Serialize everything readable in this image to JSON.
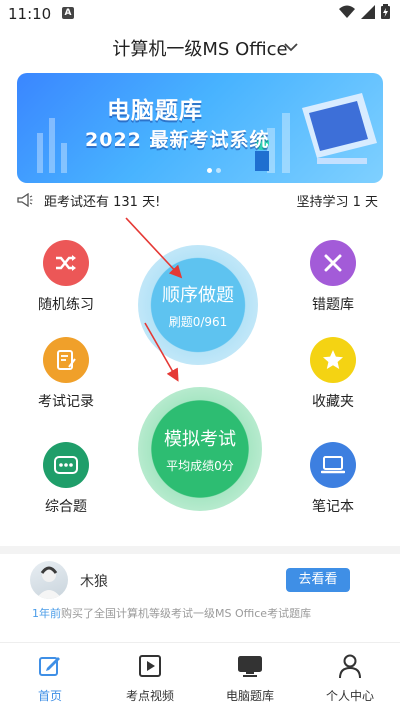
{
  "status_bar": {
    "time": "11:10",
    "indicator": "A"
  },
  "header": {
    "title": "计算机一级MS Office"
  },
  "banner": {
    "title": "电脑题库",
    "subtitle": "2022 最新考试系统"
  },
  "countdown": {
    "left_text": "距考试还有 131 天!",
    "right_text": "坚持学习 1 天"
  },
  "features": {
    "random": {
      "label": "随机练习",
      "color": "#ec5757"
    },
    "wrong": {
      "label": "错题库",
      "color": "#a35bd8"
    },
    "records": {
      "label": "考试记录",
      "color": "#f0a02a"
    },
    "favorites": {
      "label": "收藏夹",
      "color": "#f4d313"
    },
    "comprehensive": {
      "label": "综合题",
      "color": "#1f9e6a"
    },
    "notebook": {
      "label": "笔记本",
      "color": "#3d7fe0"
    }
  },
  "sequential": {
    "title": "顺序做题",
    "progress": "刷题0/961",
    "color": "#4eb4e8"
  },
  "mock": {
    "title": "模拟考试",
    "score": "平均成绩0分",
    "color": "#2dbd72"
  },
  "activity": {
    "username": "木狼",
    "button": "去看看",
    "time": "1年前",
    "text": "购买了全国计算机等级考试一级MS Office考试题库"
  },
  "tabs": [
    {
      "label": "首页",
      "icon": "edit-icon",
      "active": true
    },
    {
      "label": "考点视频",
      "icon": "video-play-icon",
      "active": false
    },
    {
      "label": "电脑题库",
      "icon": "monitor-icon",
      "active": false
    },
    {
      "label": "个人中心",
      "icon": "person-icon",
      "active": false
    }
  ],
  "colors": {
    "accent": "#3f8fe6",
    "arrow": "#e53935"
  }
}
